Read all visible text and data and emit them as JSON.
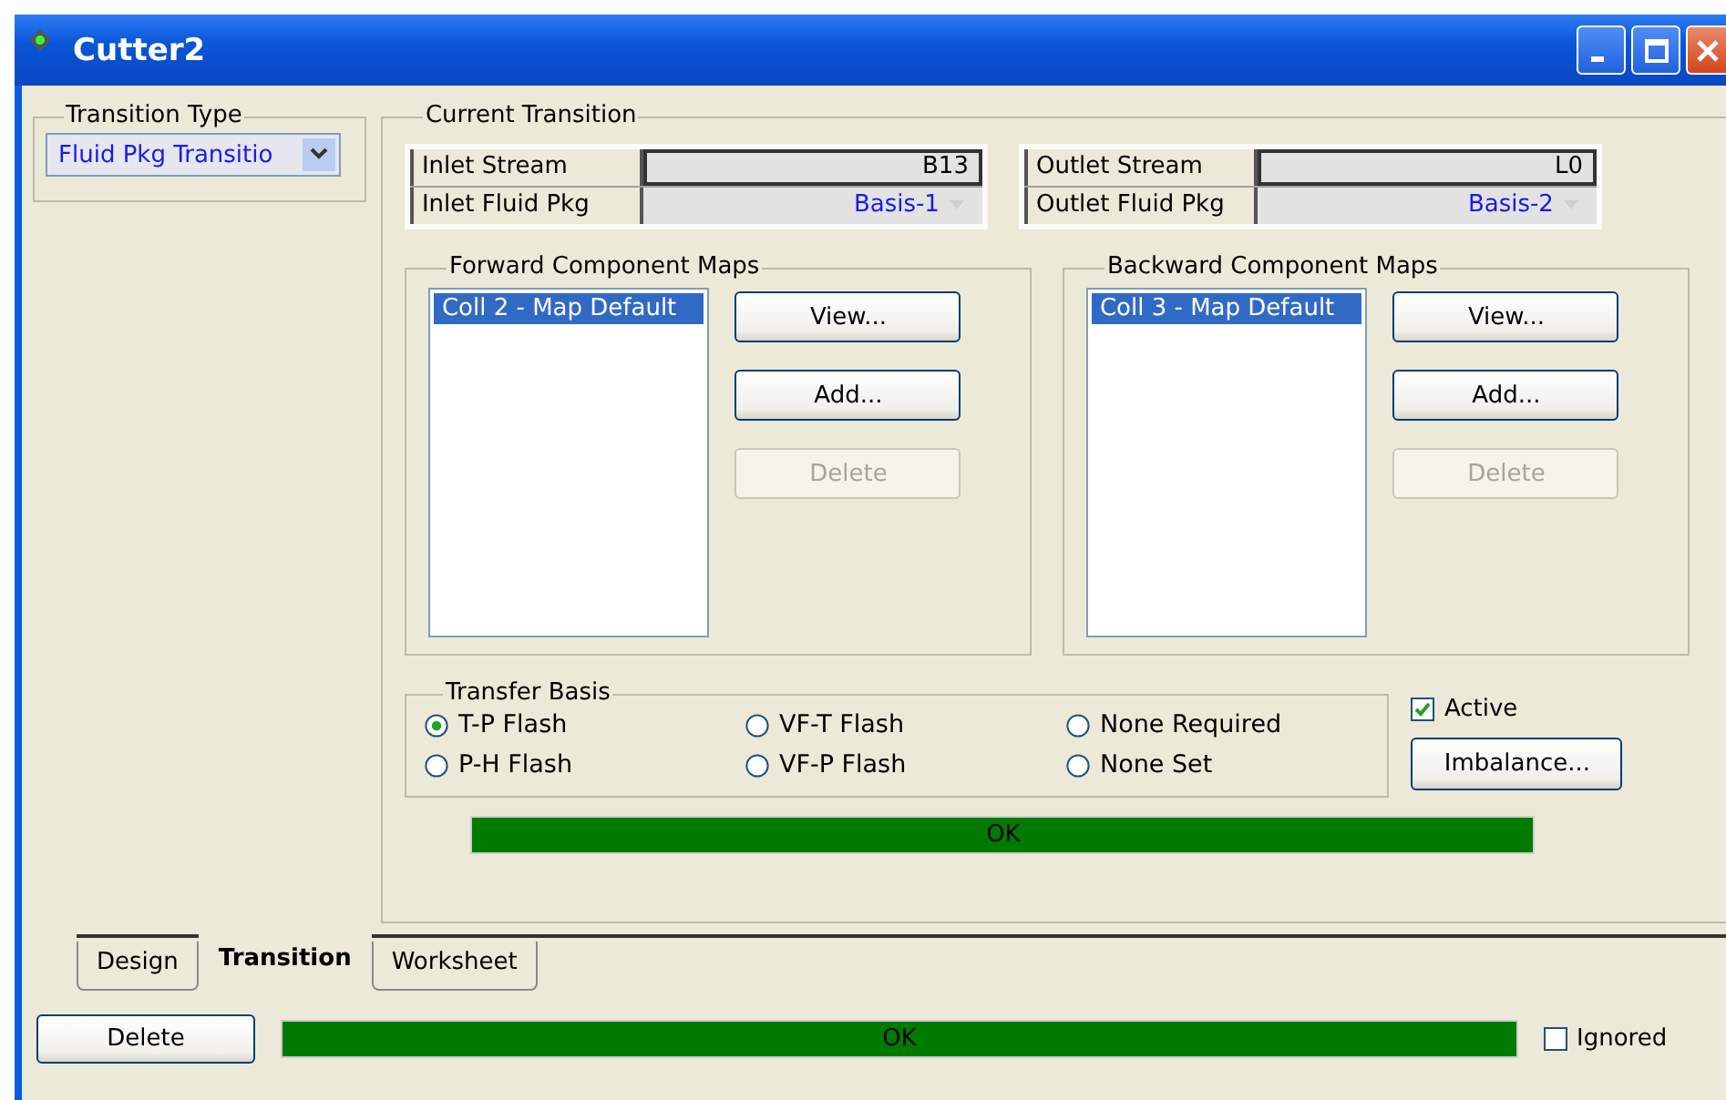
{
  "window": {
    "title": "Cutter2"
  },
  "transition_type": {
    "label": "Transition Type",
    "value": "Fluid Pkg Transitio"
  },
  "current_transition": {
    "label": "Current Transition",
    "inlet": [
      {
        "label": "Inlet Stream",
        "value": "B13",
        "kind": "stream"
      },
      {
        "label": "Inlet Fluid Pkg",
        "value": "Basis-1",
        "kind": "fluid_pkg"
      }
    ],
    "outlet": [
      {
        "label": "Outlet Stream",
        "value": "L0",
        "kind": "stream"
      },
      {
        "label": "Outlet Fluid Pkg",
        "value": "Basis-2",
        "kind": "fluid_pkg"
      }
    ],
    "maps": [
      {
        "label": "Forward Component Maps",
        "items": [
          {
            "text": "Coll 2 - Map Default",
            "selected": true
          }
        ],
        "buttons": [
          {
            "label": "View...",
            "disabled": false
          },
          {
            "label": "Add...",
            "disabled": false
          },
          {
            "label": "Delete",
            "disabled": true
          }
        ]
      },
      {
        "label": "Backward Component Maps",
        "items": [
          {
            "text": "Coll 3 - Map Default",
            "selected": true
          }
        ],
        "buttons": [
          {
            "label": "View...",
            "disabled": false
          },
          {
            "label": "Add...",
            "disabled": false
          },
          {
            "label": "Delete",
            "disabled": true
          }
        ]
      }
    ],
    "transfer_basis": {
      "label": "Transfer Basis",
      "options": [
        {
          "label": "T-P Flash",
          "selected": true
        },
        {
          "label": "VF-T Flash",
          "selected": false
        },
        {
          "label": "None Required",
          "selected": false
        },
        {
          "label": "P-H Flash",
          "selected": false
        },
        {
          "label": "VF-P Flash",
          "selected": false
        },
        {
          "label": "None Set",
          "selected": false
        }
      ]
    },
    "active": {
      "label": "Active",
      "checked": true
    },
    "imbalance_button": "Imbalance...",
    "status": "OK"
  },
  "tabs": [
    {
      "label": "Design",
      "selected": false
    },
    {
      "label": "Transition",
      "selected": true
    },
    {
      "label": "Worksheet",
      "selected": false
    }
  ],
  "footer": {
    "delete_button": "Delete",
    "status": "OK",
    "ignored": {
      "label": "Ignored",
      "checked": false
    }
  }
}
